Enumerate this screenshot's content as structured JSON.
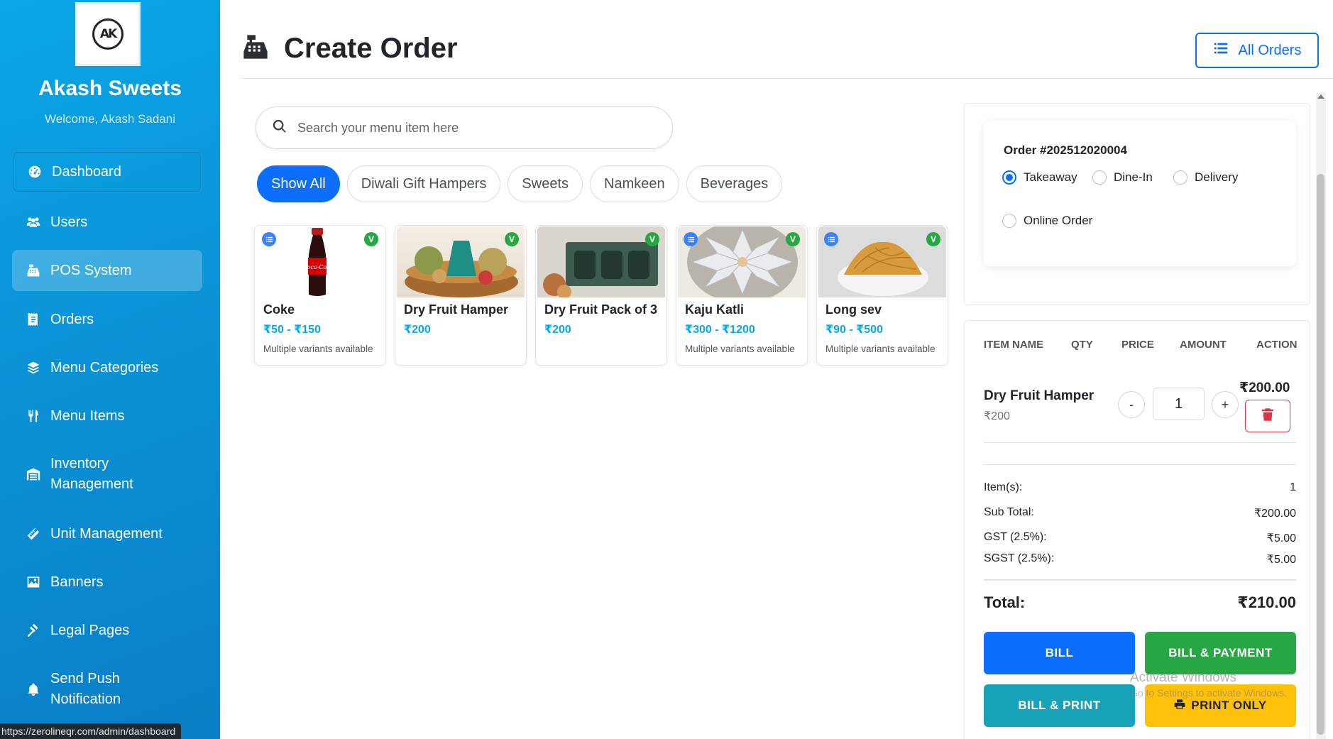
{
  "sidebar": {
    "brand": "Akash Sweets",
    "logo_text": "AK",
    "welcome": "Welcome, Akash Sadani",
    "items": [
      {
        "label": "Dashboard",
        "icon": "gauge-icon"
      },
      {
        "label": "Users",
        "icon": "users-icon"
      },
      {
        "label": "POS System",
        "icon": "cash-register-icon"
      },
      {
        "label": "Orders",
        "icon": "receipt-icon"
      },
      {
        "label": "Menu Categories",
        "icon": "layers-icon"
      },
      {
        "label": "Menu Items",
        "icon": "utensils-icon"
      },
      {
        "label": "Inventory Management",
        "icon": "warehouse-icon"
      },
      {
        "label": "Unit Management",
        "icon": "ruler-icon"
      },
      {
        "label": "Banners",
        "icon": "image-icon"
      },
      {
        "label": "Legal Pages",
        "icon": "gavel-icon"
      },
      {
        "label": "Send Push Notification",
        "icon": "bell-icon"
      }
    ],
    "active_item": "POS System"
  },
  "status_url": "https://zerolineqr.com/admin/dashboard",
  "header": {
    "title": "Create Order",
    "all_orders_label": "All Orders"
  },
  "search": {
    "placeholder": "Search your menu item here",
    "value": ""
  },
  "categories": [
    "Show All",
    "Diwali Gift Hampers",
    "Sweets",
    "Namkeen",
    "Beverages"
  ],
  "active_category": "Show All",
  "products": [
    {
      "name": "Coke",
      "price": "₹50 - ₹150",
      "note": "Multiple variants available",
      "veg": "V"
    },
    {
      "name": "Dry Fruit Hamper",
      "price": "₹200",
      "note": "",
      "veg": "V"
    },
    {
      "name": "Dry Fruit Pack of 3",
      "price": "₹200",
      "note": "",
      "veg": "V"
    },
    {
      "name": "Kaju Katli",
      "price": "₹300 - ₹1200",
      "note": "Multiple variants available",
      "veg": "V"
    },
    {
      "name": "Long sev",
      "price": "₹90 - ₹500",
      "note": "Multiple variants available",
      "veg": "V"
    }
  ],
  "order": {
    "number": "Order #202512020004",
    "types": [
      "Takeaway",
      "Dine-In",
      "Delivery",
      "Online Order"
    ],
    "selected_type": "Takeaway"
  },
  "cart": {
    "headers": [
      "ITEM NAME",
      "QTY",
      "PRICE",
      "AMOUNT",
      "ACTION"
    ],
    "items": [
      {
        "name": "Dry Fruit Hamper",
        "unit_price": "₹200",
        "qty": "1",
        "amount": "₹200.00",
        "minus": "-",
        "plus": "+"
      }
    ]
  },
  "summary": {
    "items_label": "Item(s):",
    "items_value": "1",
    "subtotal_label": "Sub Total:",
    "subtotal_value": "₹200.00",
    "gst_label": "GST (2.5%):",
    "gst_value": "₹5.00",
    "sgst_label": "SGST (2.5%):",
    "sgst_value": "₹5.00",
    "total_label": "Total:",
    "total_value": "₹210.00"
  },
  "actions": {
    "bill": "BILL",
    "bill_payment": "BILL & PAYMENT",
    "bill_print": "BILL & PRINT",
    "print_only": "PRINT ONLY"
  },
  "watermark": {
    "title": "Activate Windows",
    "subtitle": "Go to Settings to activate Windows."
  },
  "colors": {
    "primary": "#0d6efd",
    "success": "#28a745",
    "info": "#17a2b8",
    "warning": "#ffc107",
    "danger": "#dc3545",
    "price": "#0aa6e6"
  }
}
